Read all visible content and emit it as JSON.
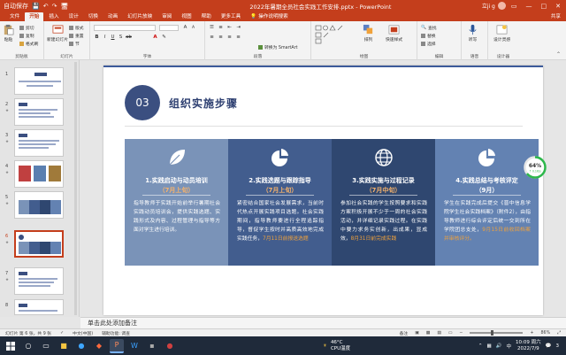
{
  "window": {
    "title": "2022年暑期全员社会实践工作安排.pptx - PowerPoint",
    "user_name": "立ji g",
    "qat": [
      "自动保存",
      "💾",
      "↶",
      "↷",
      "🖥"
    ]
  },
  "ribbon_tabs": [
    "文件",
    "开始",
    "插入",
    "设计",
    "切换",
    "动画",
    "幻灯片放映",
    "审阅",
    "视图",
    "帮助",
    "更多工具",
    "操作说明搜索"
  ],
  "active_tab": "开始",
  "share_label": "共享",
  "ribbon": {
    "clipboard": {
      "paste": "粘贴",
      "cut": "剪切",
      "copy": "复制",
      "format_painter": "格式刷",
      "label": "剪贴板"
    },
    "slides": {
      "new_slide": "新建幻灯片",
      "layout": "版式",
      "reset": "重置",
      "section": "节",
      "label": "幻灯片"
    },
    "font": {
      "label": "字体"
    },
    "paragraph": {
      "convert_smartart": "转换为 SmartArt",
      "label": "段落"
    },
    "drawing": {
      "arrange": "排列",
      "quick_styles": "快速样式",
      "label": "绘图"
    },
    "editing": {
      "find": "查找",
      "replace": "替换",
      "select": "选择",
      "label": "编辑"
    },
    "voice": {
      "dictate": "听写",
      "label": "语音"
    },
    "designer": {
      "design_ideas": "设计灵感",
      "label": "设计器"
    }
  },
  "thumbnails": [
    {
      "num": "1"
    },
    {
      "num": "2"
    },
    {
      "num": "3"
    },
    {
      "num": "4"
    },
    {
      "num": "5"
    },
    {
      "num": "6",
      "selected": true
    },
    {
      "num": "7"
    },
    {
      "num": "8"
    }
  ],
  "slide": {
    "number": "03",
    "title": "组织实施步骤",
    "cards": [
      {
        "title": "1.实践启动与动员培训",
        "date": "（7月上旬）",
        "body": "指导教师于实践开始前举行暑期社会实践动员培训会，提供实践选题、实践形式及内容、过程管理与指导等方面对学生进行培训。",
        "highlight": ""
      },
      {
        "title": "2.实践选题与跟踪指导",
        "date": "（7月上旬）",
        "body": "紧密结合国家社会发展需求，当前时代热点开展实践项目选题。社会实践期间，指导教师要进行全程追踪指导，督促学生按时并高质高效地完成实践任务，",
        "highlight": "7月11日前报送选题"
      },
      {
        "title": "3.实践实施与过程记录",
        "date": "（7月中旬）",
        "body": "参加社会实践的学生按照要求和实践方案积极开展不少于一周的社会实践活动，并详细记录实践过程。在实践中要力求务实创新，出成果，显成效，",
        "highlight": "8月31日前完成实践"
      },
      {
        "title": "4.实践总结与考核评定",
        "date": "（9月）",
        "body": "学生在实践完成后提交《晋中信息学院学生社会实践档案》（附件2），由指导教师进行综合评定后统一交到所在学院团总支处，",
        "highlight": "9月15日前收回档案并审核评分。"
      }
    ]
  },
  "gauge": {
    "percent_label": "64%",
    "sub": "↑ 0.1K/s",
    "value": 0.64,
    "color": "#2db84b"
  },
  "notes": {
    "placeholder": "单击此处添加备注"
  },
  "status": {
    "slide_info": "幻灯片 第 6 张，共 9 张",
    "lang": "中文(中国)",
    "accessibility": "辅助功能: 调查",
    "notes_btn": "备注",
    "zoom": "86%"
  },
  "taskbar": {
    "weather_temp": "46°C",
    "weather_desc": "CPU温度",
    "time": "10:09 周六",
    "date": "2022/7/9",
    "lang": "中",
    "notif_count": "3"
  },
  "colors": {
    "accent": "#c43e1c",
    "slide_blue": "#3b4f80",
    "highlight": "#f2a23a"
  }
}
